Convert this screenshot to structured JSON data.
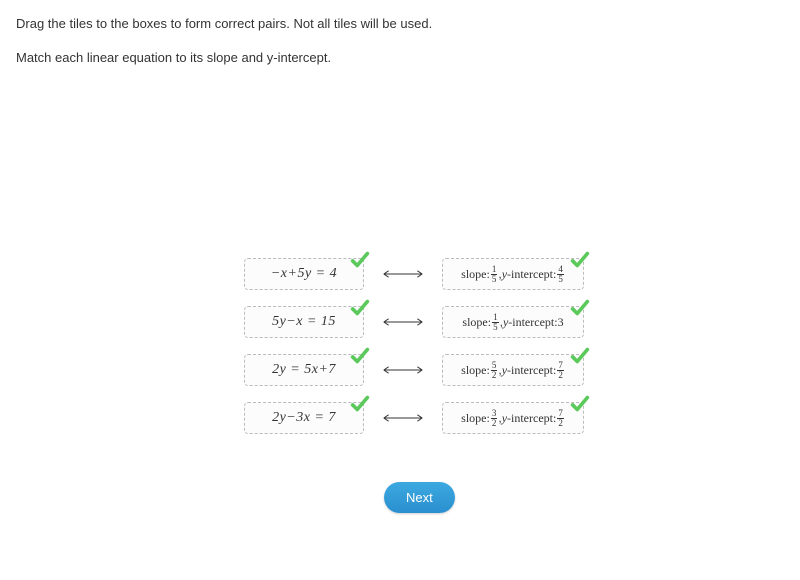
{
  "instructions": {
    "line1": "Drag the tiles to the boxes to form correct pairs. Not all tiles will be used.",
    "line2": "Match each linear equation to its slope and y-intercept."
  },
  "pairs": [
    {
      "equation": "−x+5y = 4",
      "slope_num": "1",
      "slope_den": "5",
      "yint_num": "4",
      "yint_den": "5",
      "correct_left": true,
      "correct_right": true
    },
    {
      "equation": "5y−x = 15",
      "slope_num": "1",
      "slope_den": "5",
      "yint_whole": "3",
      "correct_left": true,
      "correct_right": true
    },
    {
      "equation": "2y = 5x+7",
      "slope_num": "5",
      "slope_den": "2",
      "yint_num": "7",
      "yint_den": "2",
      "correct_left": true,
      "correct_right": true
    },
    {
      "equation": "2y−3x = 7",
      "slope_num": "3",
      "slope_den": "2",
      "yint_num": "7",
      "yint_den": "2",
      "correct_left": true,
      "correct_right": true
    }
  ],
  "labels": {
    "slope": "slope:",
    "yintercept": "-intercept: ",
    "y": "y",
    "comma": ", "
  },
  "buttons": {
    "next": "Next"
  }
}
